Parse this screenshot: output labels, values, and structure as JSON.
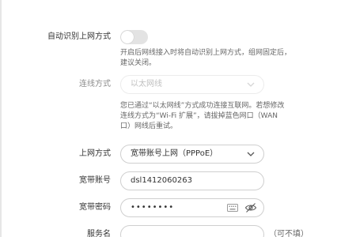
{
  "auto_detect": {
    "label": "自动识别上网方式",
    "enabled": false,
    "hint_line1": "开启后网线接入时将自动识别上网方式，组网固定后，",
    "hint_line2": "建议关闭。"
  },
  "connection_mode": {
    "label": "连线方式",
    "value": "以太网线",
    "disabled": true,
    "hint_line1": "您已通过“以太网线”方式成功连接互联网。若想修改",
    "hint_line2": "连线方式为“Wi-Fi 扩展”，请拔掉蓝色网口（WAN",
    "hint_line3": "口）网线后重试。"
  },
  "internet_mode": {
    "label": "上网方式",
    "value": "宽带账号上网（PPPoE）"
  },
  "broadband_account": {
    "label": "宽带账号",
    "value": "dsl1412060263"
  },
  "broadband_password": {
    "label": "宽带密码",
    "value": "••••••••"
  },
  "service_name": {
    "label": "服务名",
    "value": "",
    "optional_note": "（可不填）"
  },
  "icons": {
    "toggle": "toggle-switch",
    "dropdown": "chevron-down-icon",
    "keyboard": "keyboard-icon",
    "visibility": "eye-hidden-icon"
  },
  "colors": {
    "border": "#cfcfcf",
    "disabled_border": "#ececec",
    "toggle_off": "#e3e3e3",
    "text": "#333333",
    "muted_text": "#8c8c8c"
  }
}
